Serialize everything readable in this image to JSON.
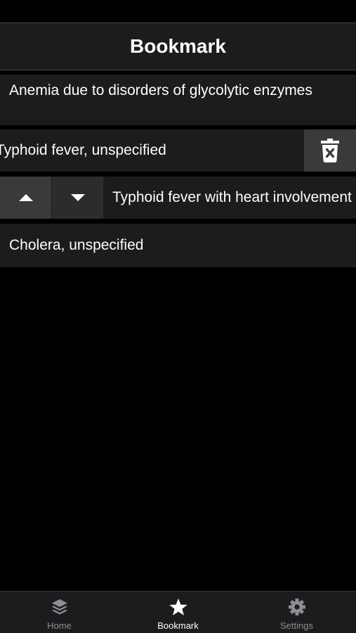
{
  "header": {
    "title": "Bookmark"
  },
  "bookmarks": [
    {
      "label": "Anemia due to disorders of glycolytic enzymes"
    },
    {
      "label": "Typhoid fever, unspecified"
    },
    {
      "label": "Typhoid fever with heart involvement"
    },
    {
      "label": "Cholera, unspecified"
    }
  ],
  "row_actions": {
    "delete_icon": "trash-x-icon",
    "move_up_icon": "caret-up-icon",
    "move_down_icon": "caret-down-icon"
  },
  "tabs": [
    {
      "label": "Home",
      "icon": "layers-icon",
      "active": false
    },
    {
      "label": "Bookmark",
      "icon": "star-icon",
      "active": true
    },
    {
      "label": "Settings",
      "icon": "gear-icon",
      "active": false
    }
  ],
  "colors": {
    "background": "#000000",
    "row_background": "#1c1c1e",
    "action_button": "#3a3a3c",
    "tab_active": "#ffffff",
    "tab_inactive": "#8e8e93"
  }
}
